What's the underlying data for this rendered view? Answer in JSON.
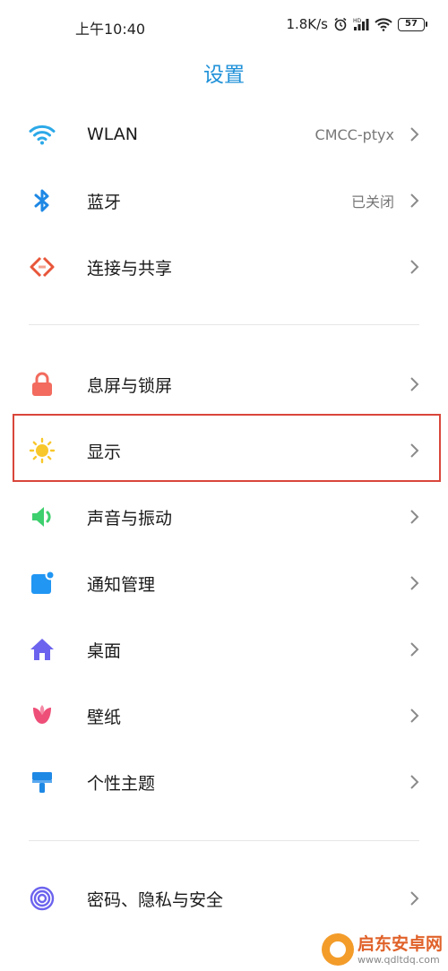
{
  "status_bar": {
    "time": "上午10:40",
    "network_speed": "1.8K/s",
    "battery_level": "57"
  },
  "page": {
    "title": "设置"
  },
  "section1": [
    {
      "label": "WLAN",
      "value": "CMCC-ptyx",
      "icon": "wifi-icon",
      "color": "#2ca9e8"
    },
    {
      "label": "蓝牙",
      "value": "已关闭",
      "icon": "bluetooth-icon",
      "color": "#1e88e5"
    },
    {
      "label": "连接与共享",
      "value": "",
      "icon": "connection-share-icon",
      "color": "#e8563a"
    }
  ],
  "section2": [
    {
      "label": "息屏与锁屏",
      "icon": "lock-icon",
      "color": "#f26b5e"
    },
    {
      "label": "显示",
      "icon": "sun-icon",
      "color": "#f8c72b",
      "highlighted": true
    },
    {
      "label": "声音与振动",
      "icon": "speaker-icon",
      "color": "#3ecf6e"
    },
    {
      "label": "通知管理",
      "icon": "notification-icon",
      "color": "#2196f3"
    },
    {
      "label": "桌面",
      "icon": "home-icon",
      "color": "#6c63ee"
    },
    {
      "label": "壁纸",
      "icon": "tulip-icon",
      "color": "#ee4f78"
    },
    {
      "label": "个性主题",
      "icon": "paint-brush-icon",
      "color": "#1e88e5"
    }
  ],
  "section3": [
    {
      "label": "密码、隐私与安全",
      "icon": "fingerprint-icon",
      "color": "#6c63ee"
    }
  ],
  "watermark": {
    "title": "启东安卓网",
    "url": "www.qdltdq.com"
  }
}
